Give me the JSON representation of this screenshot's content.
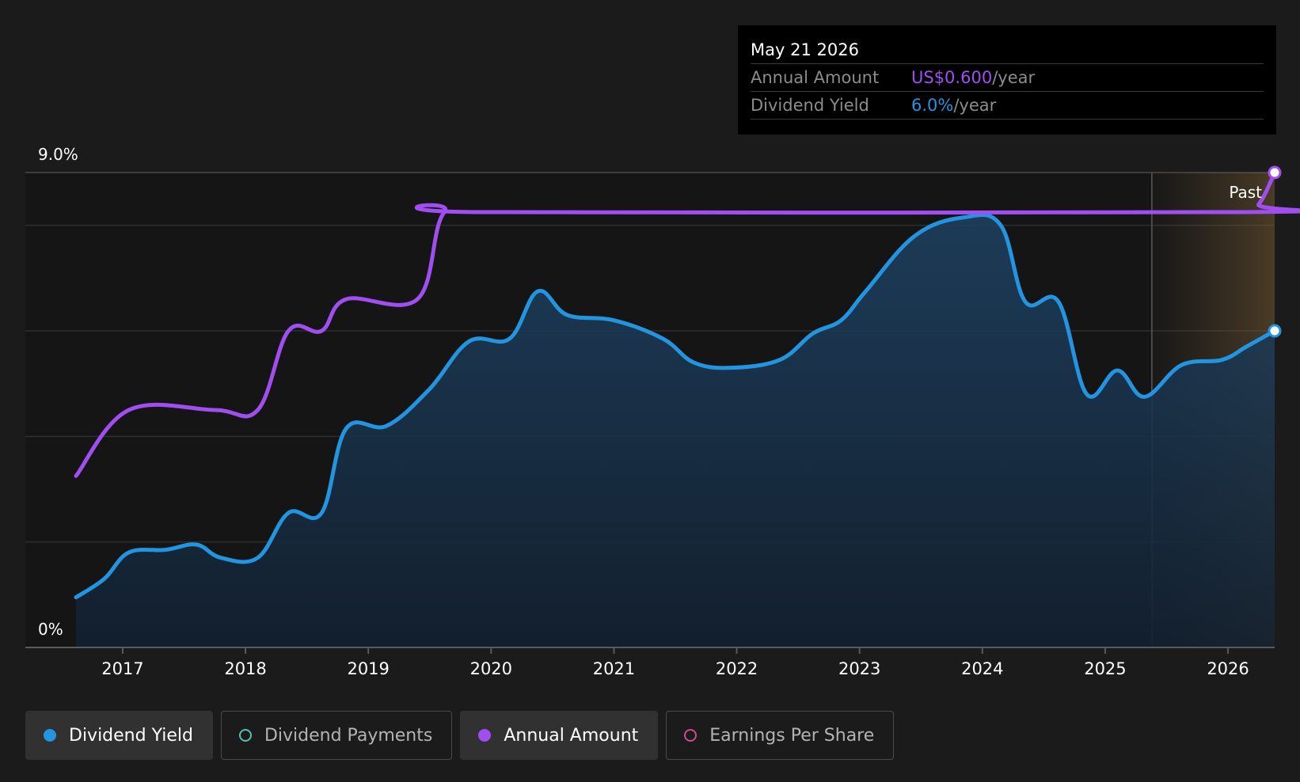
{
  "tooltip": {
    "date": "May 21 2026",
    "rows": [
      {
        "label": "Annual Amount",
        "value": "US$0.600",
        "unit": "/year",
        "color": "#a04ef0"
      },
      {
        "label": "Dividend Yield",
        "value": "6.0%",
        "unit": "/year",
        "color": "#2394df"
      }
    ]
  },
  "legend": [
    {
      "label": "Dividend Yield",
      "active": true,
      "filled": true,
      "color": "#2394df"
    },
    {
      "label": "Dividend Payments",
      "active": false,
      "filled": false,
      "color": "#4fc3b3"
    },
    {
      "label": "Annual Amount",
      "active": true,
      "filled": true,
      "color": "#a04ef0"
    },
    {
      "label": "Earnings Per Share",
      "active": false,
      "filled": false,
      "color": "#d04a8e"
    }
  ],
  "chart_data": {
    "type": "line",
    "y_top_label": "9.0%",
    "y_bottom_label": "0%",
    "ylim": [
      0,
      9.0
    ],
    "x_ticks": [
      "2017",
      "2018",
      "2019",
      "2020",
      "2021",
      "2022",
      "2023",
      "2024",
      "2025",
      "2026"
    ],
    "past_label": "Past",
    "past_start": 2025.38,
    "xlim": [
      2016.62,
      2026.38
    ],
    "series": [
      {
        "name": "Dividend Yield",
        "color": "#2394df",
        "area": true,
        "points": [
          [
            2016.62,
            0.95
          ],
          [
            2016.85,
            1.3
          ],
          [
            2017.05,
            1.8
          ],
          [
            2017.35,
            1.85
          ],
          [
            2017.6,
            1.95
          ],
          [
            2017.8,
            1.7
          ],
          [
            2018.1,
            1.7
          ],
          [
            2018.35,
            2.55
          ],
          [
            2018.62,
            2.55
          ],
          [
            2018.82,
            4.15
          ],
          [
            2019.15,
            4.2
          ],
          [
            2019.5,
            4.9
          ],
          [
            2019.82,
            5.8
          ],
          [
            2020.15,
            5.85
          ],
          [
            2020.38,
            6.75
          ],
          [
            2020.62,
            6.3
          ],
          [
            2021.0,
            6.2
          ],
          [
            2021.4,
            5.85
          ],
          [
            2021.65,
            5.4
          ],
          [
            2021.95,
            5.3
          ],
          [
            2022.35,
            5.45
          ],
          [
            2022.62,
            5.95
          ],
          [
            2022.85,
            6.2
          ],
          [
            2023.05,
            6.75
          ],
          [
            2023.45,
            7.8
          ],
          [
            2023.85,
            8.15
          ],
          [
            2024.15,
            8.0
          ],
          [
            2024.35,
            6.55
          ],
          [
            2024.62,
            6.55
          ],
          [
            2024.85,
            4.8
          ],
          [
            2025.1,
            5.25
          ],
          [
            2025.32,
            4.75
          ],
          [
            2025.62,
            5.35
          ],
          [
            2025.95,
            5.45
          ],
          [
            2026.15,
            5.7
          ],
          [
            2026.38,
            6.0
          ]
        ]
      },
      {
        "name": "Annual Amount",
        "color": "#a04ef0",
        "area": false,
        "points": [
          [
            2016.62,
            3.25
          ],
          [
            2017.05,
            4.5
          ],
          [
            2017.75,
            4.5
          ],
          [
            2018.1,
            4.5
          ],
          [
            2018.35,
            6.0
          ],
          [
            2018.62,
            6.0
          ],
          [
            2018.82,
            6.6
          ],
          [
            2019.4,
            6.6
          ],
          [
            2019.62,
            8.25
          ],
          [
            2020.0,
            8.25
          ],
          [
            2026.1,
            8.25
          ],
          [
            2026.25,
            8.4
          ],
          [
            2026.38,
            9.0
          ]
        ]
      }
    ]
  }
}
